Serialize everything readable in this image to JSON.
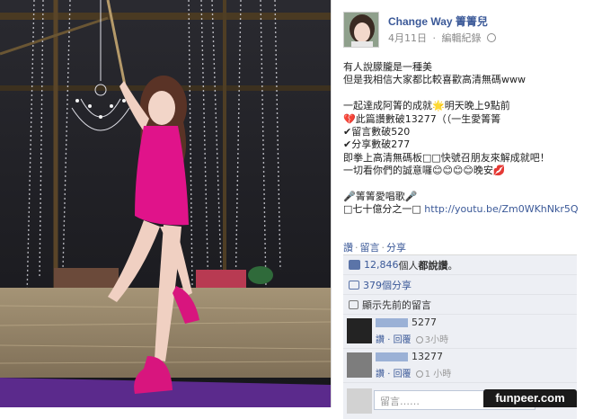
{
  "colors": {
    "link": "#3b5998",
    "ufi_bg": "#edeff4",
    "photo_bg": "#1b1b1f",
    "dress": "#e0138a",
    "floor": "#5b2a8c"
  },
  "post": {
    "author": "Change Way 箐箐兒",
    "date": "4月11日",
    "edit_label": "編輯紀錄",
    "separator": "·",
    "lines": [
      "有人說朦朧是一種美",
      "但是我相信大家都比較喜歡高清無碼www",
      "",
      "一起達成阿箐的成就🌟明天晚上9點前",
      "💔此篇讚數破13277（（一生愛箐箐",
      "✔留言數破520",
      "✔分享數破277",
      "即拳上高清無碼板□□快號召朋友來解成就吧！",
      "一切看你們的誠意囉😊😊😊😊晚安💋",
      "",
      "🎤箐箐愛唱歌🎤"
    ],
    "link_prefix": "□七十億分之一□ ",
    "link_text": "http://youtu.be/Zm0WKhNkr5Q",
    "actions": {
      "like": "讚",
      "comment": "留言",
      "share": "分享"
    }
  },
  "ufi": {
    "likes_count": "12,846",
    "likes_suffix": " 個人",
    "likes_link": "都說讚",
    "likes_end": "。",
    "shares": "379個分享",
    "view_previous": "顯示先前的留言",
    "comments": [
      {
        "text": "5277",
        "like": "讚",
        "reply": "回覆",
        "time": "3小時",
        "sep": "·"
      },
      {
        "text": "13277",
        "like": "讚",
        "reply": "回覆",
        "time": "1 小時",
        "sep": "·"
      }
    ],
    "composer_placeholder": "留言……"
  },
  "watermark": "funpeer.com"
}
